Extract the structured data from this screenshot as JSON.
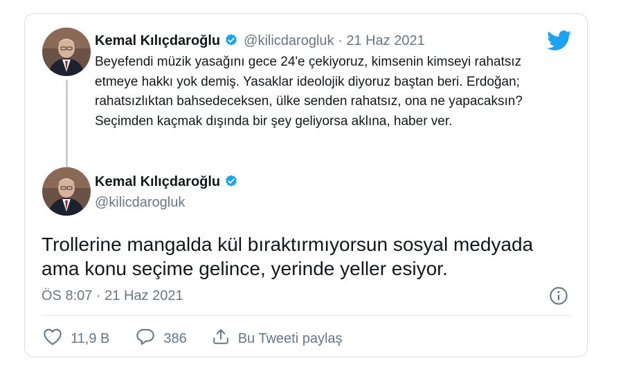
{
  "colors": {
    "accent": "#1da1f2",
    "muted": "#657786",
    "text": "#14171a",
    "border": "#d6dde3"
  },
  "quoted_tweet": {
    "author_name": "Kemal Kılıçdaroğlu",
    "handle": "@kilicdarogluk",
    "separator": "·",
    "date": "21 Haz 2021",
    "text": "Beyefendi müzik yasağını gece 24'e çekiyoruz, kimsenin kimseyi rahatsız etmeye hakkı yok demiş. Yasaklar ideolojik diyoruz baştan beri. Erdoğan; rahatsızlıktan bahsedeceksen, ülke senden rahatsız, ona ne yapacaksın? Seçimden kaçmak dışında bir şey geliyorsa aklına, haber ver."
  },
  "main_tweet": {
    "author_name": "Kemal Kılıçdaroğlu",
    "handle": "@kilicdarogluk",
    "text": "Trollerine mangalda kül bıraktırmıyorsun sosyal medyada ama konu seçime gelince, yerinde yeller esiyor.",
    "timestamp": "ÖS 8:07 · 21 Haz 2021"
  },
  "actions": {
    "likes": "11,9 B",
    "replies": "386",
    "share_label": "Bu Tweeti paylaş"
  },
  "icons": {
    "verified": "verified-badge-icon",
    "twitter": "twitter-bird-icon",
    "info": "info-icon",
    "like": "heart-icon",
    "reply": "reply-bubble-icon",
    "share": "share-upload-icon"
  }
}
